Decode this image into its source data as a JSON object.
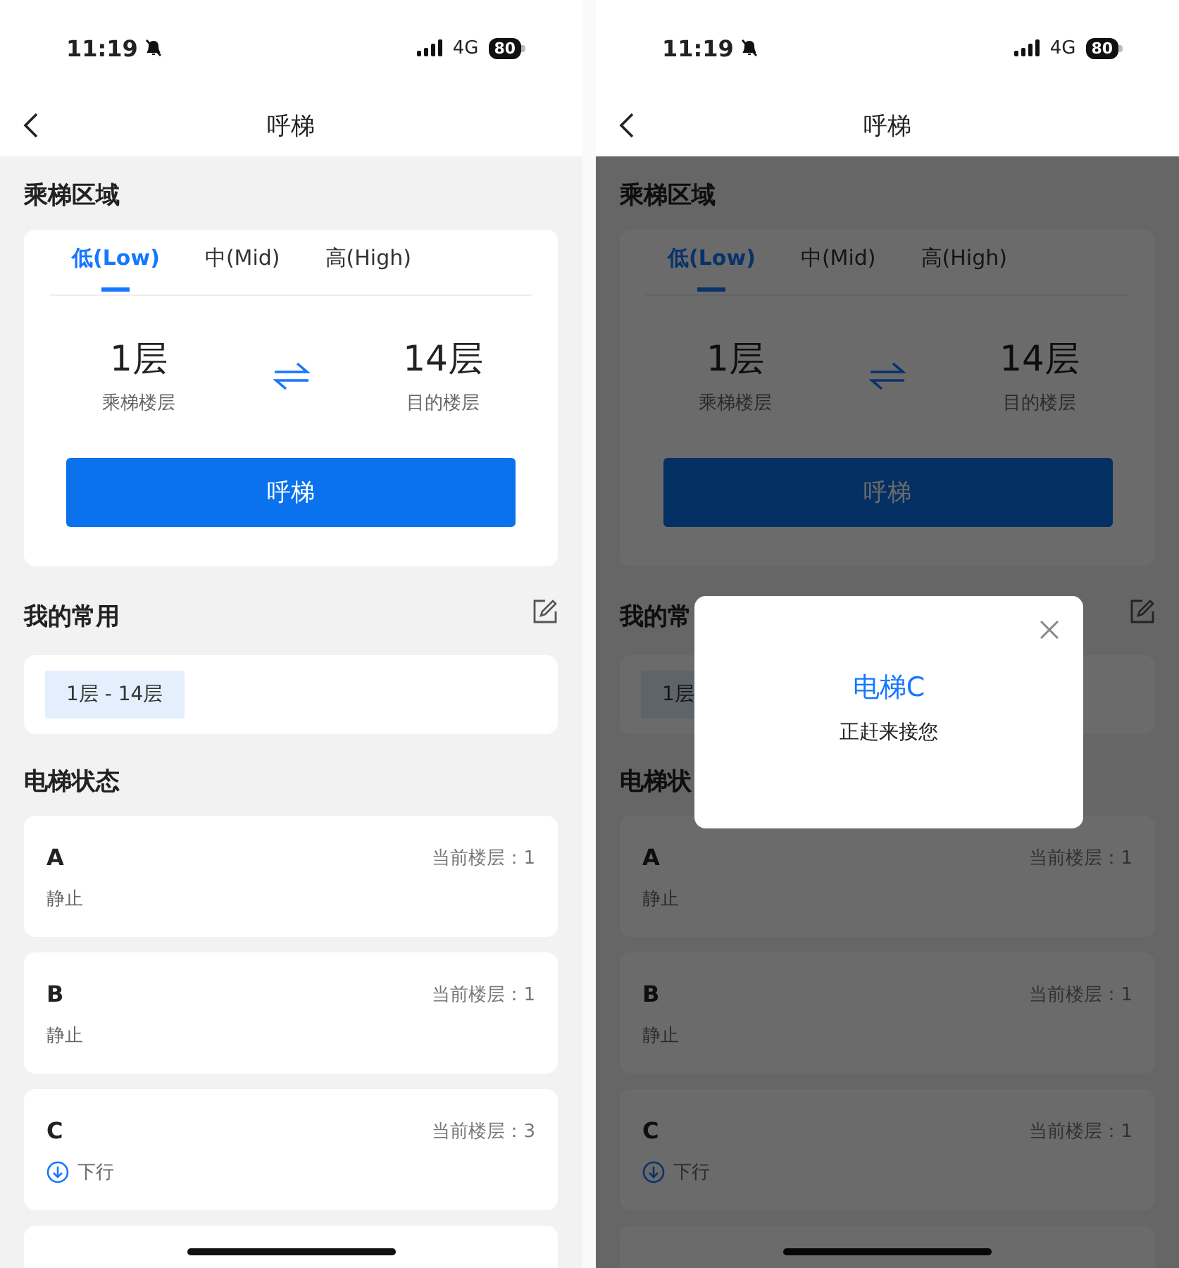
{
  "screens": [
    {
      "status_bar": {
        "time": "11:19",
        "network": "4G",
        "battery": "80"
      },
      "nav": {
        "title": "呼梯"
      },
      "zone": {
        "title": "乘梯区域",
        "tabs": [
          {
            "label": "低(Low)",
            "selected": true
          },
          {
            "label": "中(Mid)",
            "selected": false
          },
          {
            "label": "高(High)",
            "selected": false
          }
        ],
        "from": {
          "value": "1层",
          "label": "乘梯楼层"
        },
        "to": {
          "value": "14层",
          "label": "目的楼层"
        },
        "button": "呼梯"
      },
      "favorites": {
        "title": "我的常用",
        "chips": [
          "1层 - 14层"
        ]
      },
      "elevator_status": {
        "title": "电梯状态",
        "elevators": [
          {
            "name": "A",
            "floor": "当前楼层：1",
            "kind": "stopped",
            "status": "静止"
          },
          {
            "name": "B",
            "floor": "当前楼层：1",
            "kind": "stopped",
            "status": "静止"
          },
          {
            "name": "C",
            "floor": "当前楼层：3",
            "kind": "down",
            "status": "下行"
          }
        ],
        "more_below": true
      }
    },
    {
      "status_bar": {
        "time": "11:19",
        "network": "4G",
        "battery": "80"
      },
      "nav": {
        "title": "呼梯"
      },
      "zone": {
        "title": "乘梯区域",
        "tabs": [
          {
            "label": "低(Low)",
            "selected": true
          },
          {
            "label": "中(Mid)",
            "selected": false
          },
          {
            "label": "高(High)",
            "selected": false
          }
        ],
        "from": {
          "value": "1层",
          "label": "乘梯楼层"
        },
        "to": {
          "value": "14层",
          "label": "目的楼层"
        },
        "button": "呼梯"
      },
      "favorites": {
        "title": "我的常",
        "chips": [
          "1层"
        ]
      },
      "elevator_status": {
        "title": "电梯状",
        "elevators": [
          {
            "name": "A",
            "floor": "当前楼层：1",
            "kind": "stopped",
            "status": "静止"
          },
          {
            "name": "B",
            "floor": "当前楼层：1",
            "kind": "stopped",
            "status": "静止"
          },
          {
            "name": "C",
            "floor": "当前楼层：1",
            "kind": "down",
            "status": "下行"
          }
        ],
        "more_below": true
      },
      "dialog": {
        "title": "电梯C",
        "message": "正赶来接您"
      }
    }
  ]
}
